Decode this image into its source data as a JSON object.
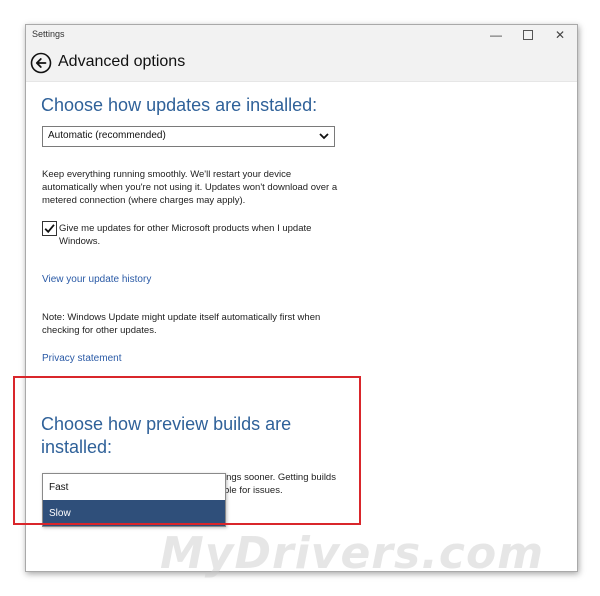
{
  "window": {
    "app_title": "Settings",
    "controls": {
      "minimize": "—",
      "close": "✕"
    }
  },
  "header": {
    "back_icon": "back-arrow-icon",
    "title": "Advanced options"
  },
  "updates": {
    "heading": "Choose how updates are installed:",
    "dropdown_value": "Automatic (recommended)",
    "description_lines": [
      "Keep everything running smoothly. We'll restart your device",
      "automatically when you're not using it. Updates won't download over a",
      "metered connection (where charges may apply)."
    ],
    "checkbox_checked": true,
    "checkbox_label_lines": [
      "Give me updates for other Microsoft products when I update",
      "Windows."
    ],
    "history_link": "View your update history",
    "note_lines": [
      "Note: Windows Update might update itself automatically first when",
      "checking for other updates."
    ],
    "privacy_link": "Privacy statement"
  },
  "preview": {
    "heading_lines": [
      "Choose how preview builds are",
      "installed:"
    ],
    "obscured_text_lines": [
      "ings sooner. Getting builds",
      "ble for issues."
    ],
    "options": [
      "Fast",
      "Slow"
    ],
    "selected": "Slow"
  },
  "colors": {
    "heading_blue": "#2f6199",
    "link_blue": "#2a5aa6",
    "selected_option": "#2f4f7a",
    "highlight_border": "#d9262b"
  },
  "watermark": "MyDrivers.com"
}
